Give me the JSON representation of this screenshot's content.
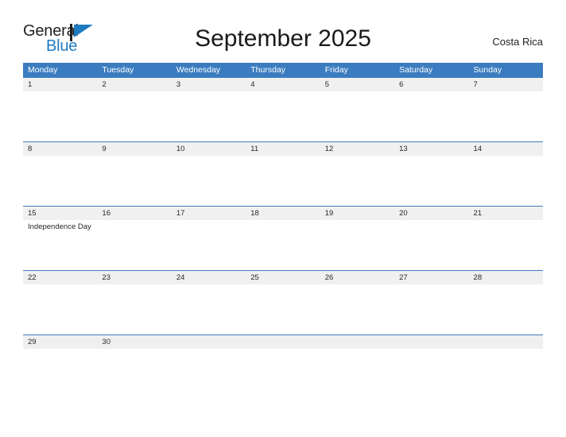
{
  "brand": {
    "name_part1": "General",
    "name_part2": "Blue",
    "flag_icon": "blue-flag-icon",
    "color_primary": "#1f7bc1",
    "color_text": "#231f20"
  },
  "header": {
    "title": "September 2025",
    "country": "Costa Rica"
  },
  "theme": {
    "header_blue": "#3b7cc0",
    "date_band_gray": "#f0f0f0",
    "page_background": "#ffffff",
    "text_color": "#262626"
  },
  "calendar": {
    "weekdays": [
      "Monday",
      "Tuesday",
      "Wednesday",
      "Thursday",
      "Friday",
      "Saturday",
      "Sunday"
    ],
    "weeks": [
      {
        "days": [
          {
            "num": "1",
            "events": []
          },
          {
            "num": "2",
            "events": []
          },
          {
            "num": "3",
            "events": []
          },
          {
            "num": "4",
            "events": []
          },
          {
            "num": "5",
            "events": []
          },
          {
            "num": "6",
            "events": []
          },
          {
            "num": "7",
            "events": []
          }
        ]
      },
      {
        "days": [
          {
            "num": "8",
            "events": []
          },
          {
            "num": "9",
            "events": []
          },
          {
            "num": "10",
            "events": []
          },
          {
            "num": "11",
            "events": []
          },
          {
            "num": "12",
            "events": []
          },
          {
            "num": "13",
            "events": []
          },
          {
            "num": "14",
            "events": []
          }
        ]
      },
      {
        "days": [
          {
            "num": "15",
            "events": [
              "Independence Day"
            ]
          },
          {
            "num": "16",
            "events": []
          },
          {
            "num": "17",
            "events": []
          },
          {
            "num": "18",
            "events": []
          },
          {
            "num": "19",
            "events": []
          },
          {
            "num": "20",
            "events": []
          },
          {
            "num": "21",
            "events": []
          }
        ]
      },
      {
        "days": [
          {
            "num": "22",
            "events": []
          },
          {
            "num": "23",
            "events": []
          },
          {
            "num": "24",
            "events": []
          },
          {
            "num": "25",
            "events": []
          },
          {
            "num": "26",
            "events": []
          },
          {
            "num": "27",
            "events": []
          },
          {
            "num": "28",
            "events": []
          }
        ]
      },
      {
        "days": [
          {
            "num": "29",
            "events": []
          },
          {
            "num": "30",
            "events": []
          },
          {
            "num": "",
            "events": []
          },
          {
            "num": "",
            "events": []
          },
          {
            "num": "",
            "events": []
          },
          {
            "num": "",
            "events": []
          },
          {
            "num": "",
            "events": []
          }
        ]
      }
    ]
  }
}
